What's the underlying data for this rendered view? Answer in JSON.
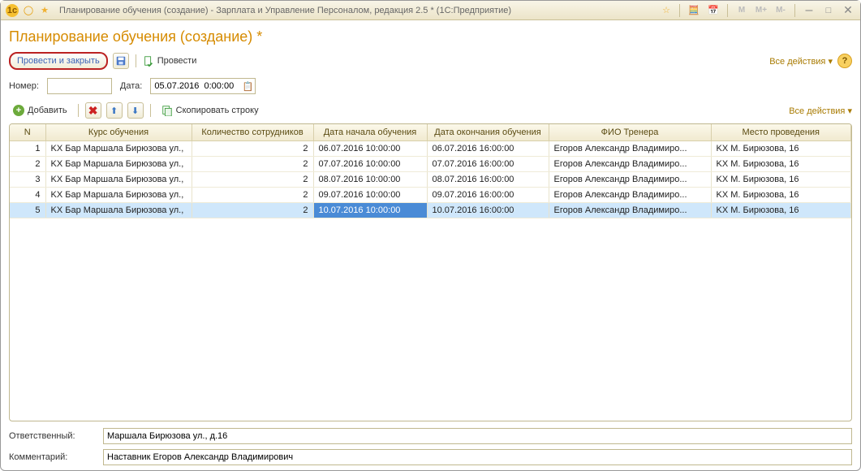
{
  "window": {
    "title": "Планирование обучения (создание) - Зарплата и Управление Персоналом, редакция 2.5 * (1С:Предприятие)"
  },
  "page": {
    "heading": "Планирование обучения (создание) *"
  },
  "toolbar": {
    "submit_close": "Провести и закрыть",
    "submit": "Провести",
    "all_actions": "Все действия"
  },
  "fields": {
    "number_label": "Номер:",
    "number_value": "",
    "date_label": "Дата:",
    "date_value": "05.07.2016  0:00:00"
  },
  "grid_toolbar": {
    "add": "Добавить",
    "copy_row": "Скопировать строку",
    "all_actions": "Все действия"
  },
  "grid": {
    "columns": {
      "n": "N",
      "course": "Курс обучения",
      "qty": "Количество сотрудников",
      "start": "Дата начала обучения",
      "end": "Дата окончания обучения",
      "trainer": "ФИО Тренера",
      "place": "Место проведения"
    },
    "rows": [
      {
        "n": "1",
        "course": "KX Бар Маршала Бирюзова ул.,",
        "qty": "2",
        "start": "06.07.2016 10:00:00",
        "end": "06.07.2016 16:00:00",
        "trainer": "Егоров Александр Владимиро...",
        "place": "KX М. Бирюзова, 16"
      },
      {
        "n": "2",
        "course": "KX Бар Маршала Бирюзова ул.,",
        "qty": "2",
        "start": "07.07.2016 10:00:00",
        "end": "07.07.2016 16:00:00",
        "trainer": "Егоров Александр Владимиро...",
        "place": "KX М. Бирюзова, 16"
      },
      {
        "n": "3",
        "course": "KX Бар Маршала Бирюзова ул.,",
        "qty": "2",
        "start": "08.07.2016 10:00:00",
        "end": "08.07.2016 16:00:00",
        "trainer": "Егоров Александр Владимиро...",
        "place": "KX М. Бирюзова, 16"
      },
      {
        "n": "4",
        "course": "KX Бар Маршала Бирюзова ул.,",
        "qty": "2",
        "start": "09.07.2016 10:00:00",
        "end": "09.07.2016 16:00:00",
        "trainer": "Егоров Александр Владимиро...",
        "place": "KX М. Бирюзова, 16"
      },
      {
        "n": "5",
        "course": "KX Бар Маршала Бирюзова ул.,",
        "qty": "2",
        "start": "10.07.2016 10:00:00",
        "end": "10.07.2016 16:00:00",
        "trainer": "Егоров Александр Владимиро...",
        "place": "KX М. Бирюзова, 16"
      }
    ],
    "selected_index": 4,
    "focus_col": "start"
  },
  "bottom": {
    "responsible_label": "Ответственный:",
    "responsible_value": "Маршала Бирюзова ул., д.16",
    "comment_label": "Комментарий:",
    "comment_value": "Наставник Егоров Александр Владимирович"
  },
  "titlebar_buttons": {
    "m": "M",
    "mp": "M+",
    "mm": "M-"
  }
}
